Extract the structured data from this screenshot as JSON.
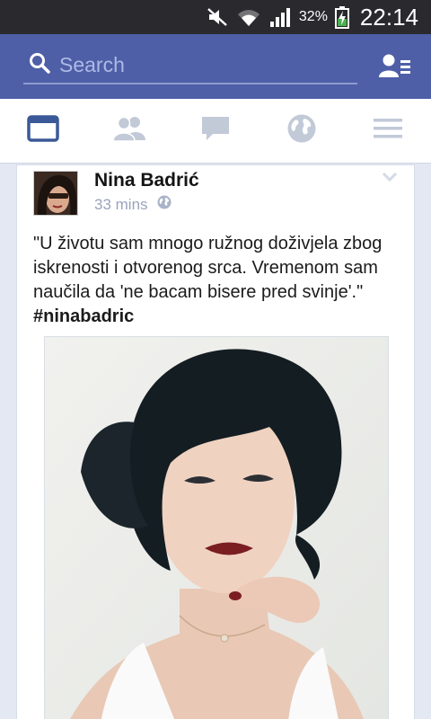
{
  "status_bar": {
    "battery_percent": "32%",
    "time": "22:14",
    "icons": [
      "mute-icon",
      "wifi-icon",
      "signal-icon",
      "battery-charging-icon"
    ]
  },
  "search": {
    "placeholder": "Search",
    "icon": "search-icon",
    "right_icon": "friend-requests-icon"
  },
  "tabs": [
    {
      "name": "news-feed",
      "icon": "news-feed-icon",
      "active": true
    },
    {
      "name": "friends",
      "icon": "friends-icon",
      "active": false
    },
    {
      "name": "messages",
      "icon": "messages-icon",
      "active": false
    },
    {
      "name": "notifications",
      "icon": "globe-icon",
      "active": false
    },
    {
      "name": "more",
      "icon": "menu-icon",
      "active": false
    }
  ],
  "post": {
    "author": "Nina Badrić",
    "time": "33 mins",
    "privacy_icon": "globe-icon",
    "text": "\"U životu sam mnogo ružnog doživjela zbog iskrenosti i otvorenog srca. Vremenom sam naučila da 'ne bacam bisere pred svinje'.\" ",
    "hashtag": "#ninabadric"
  },
  "colors": {
    "status_bar": "#2a2a2e",
    "header": "#4e5fa7",
    "accent": "#3b5998",
    "inactive_tab": "#c2cad8",
    "feed_bg": "#e3e8f2"
  }
}
